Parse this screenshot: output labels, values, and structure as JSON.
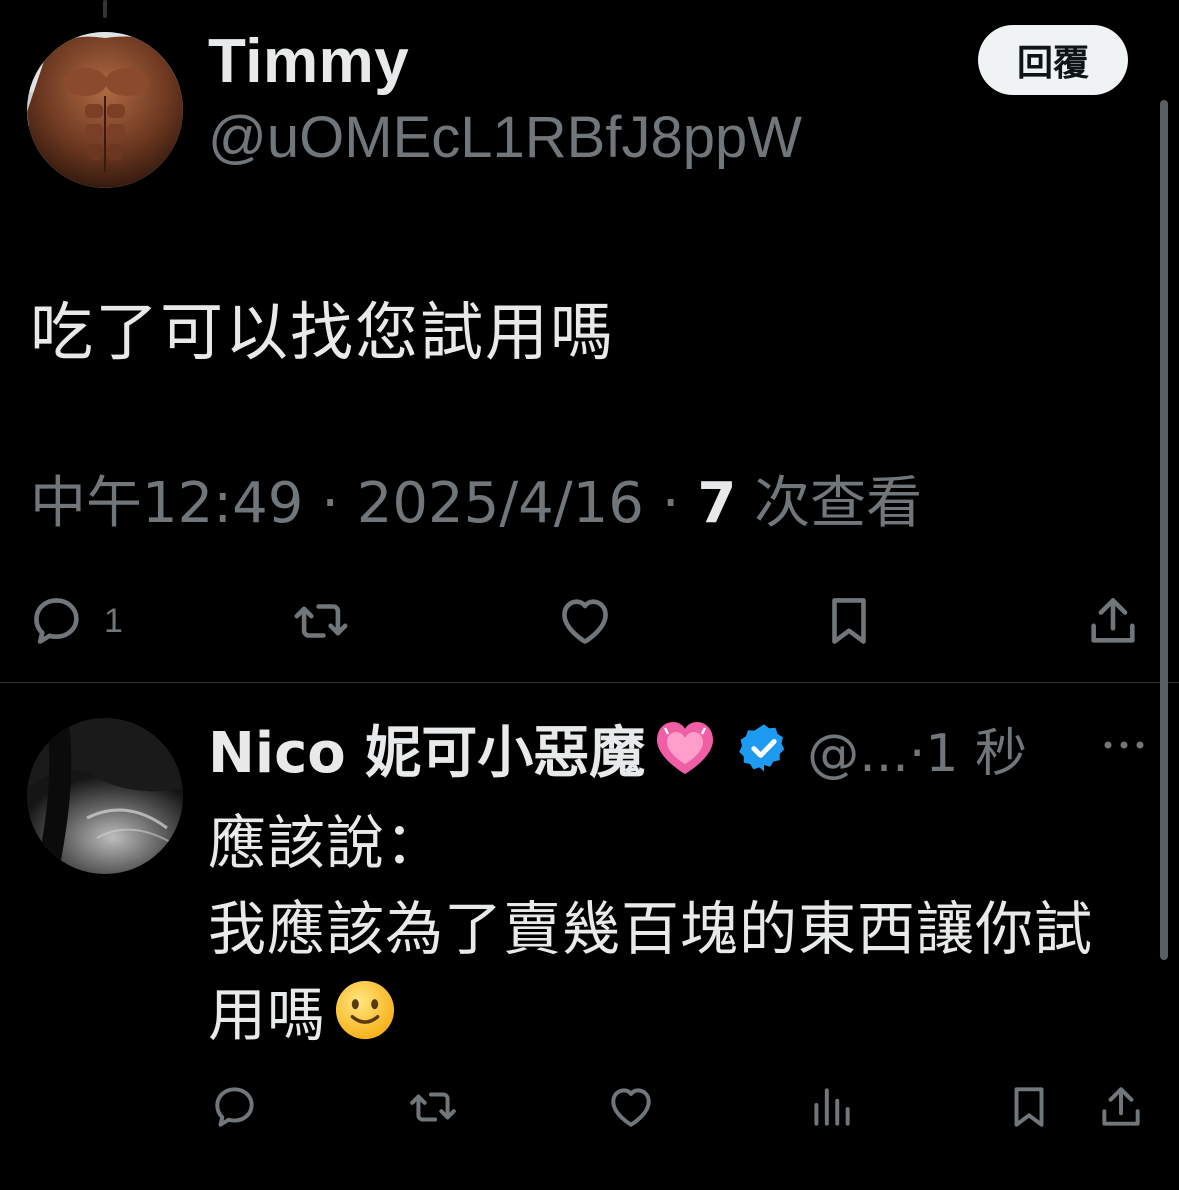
{
  "main_tweet": {
    "name": "Timmy",
    "handle": "@uOMEcL1RBfJ8ppW",
    "reply_button_label": "回覆",
    "text": "吃了可以找您試用嗎",
    "time": "中午12:49",
    "date": "2025/4/16",
    "separator": " · ",
    "views_count": "7",
    "views_label": " 次查看",
    "actions": {
      "reply_count": "1",
      "reply_icon": "comment-icon",
      "retweet_icon": "retweet-icon",
      "like_icon": "heart-icon",
      "bookmark_icon": "bookmark-icon",
      "share_icon": "share-icon"
    }
  },
  "reply_tweet": {
    "name": "Nico 妮可小惡魔",
    "name_emoji": "pink-heart",
    "verified_icon": "verified-badge-icon",
    "handle_time": "@...·1 秒",
    "text_lines": [
      "應該說：",
      "我應該為了賣幾百塊的東西讓你試",
      "用嗎"
    ],
    "text_emoji": "slightly-smiling-face",
    "actions": [
      "comment-icon",
      "retweet-icon",
      "heart-icon",
      "analytics-icon",
      "bookmark-icon",
      "share-icon"
    ]
  },
  "colors": {
    "background": "#000000",
    "primary_text": "#e7e9ea",
    "secondary_text": "#71767b",
    "verified": "#1d9bf0",
    "divider": "#2f3336",
    "reply_button_bg": "#eff3f4"
  }
}
